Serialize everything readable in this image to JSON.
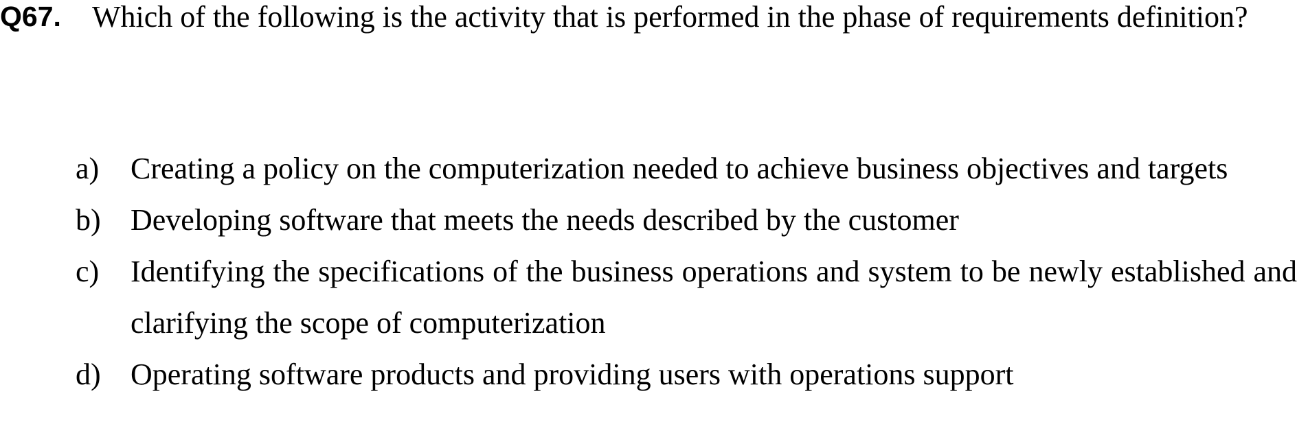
{
  "question": {
    "number": "Q67.",
    "text": "Which of the following is the activity that is performed in the phase of requirements definition?"
  },
  "options": [
    {
      "letter": "a)",
      "text": "Creating a policy on the computerization needed to achieve business objectives and targets"
    },
    {
      "letter": "b)",
      "text": "Developing software that meets the needs described by the customer"
    },
    {
      "letter": "c)",
      "text": "Identifying the specifications of the business operations and system to be newly established and clarifying the scope of computerization"
    },
    {
      "letter": "d)",
      "text": "Operating software products and providing users with operations support"
    }
  ]
}
